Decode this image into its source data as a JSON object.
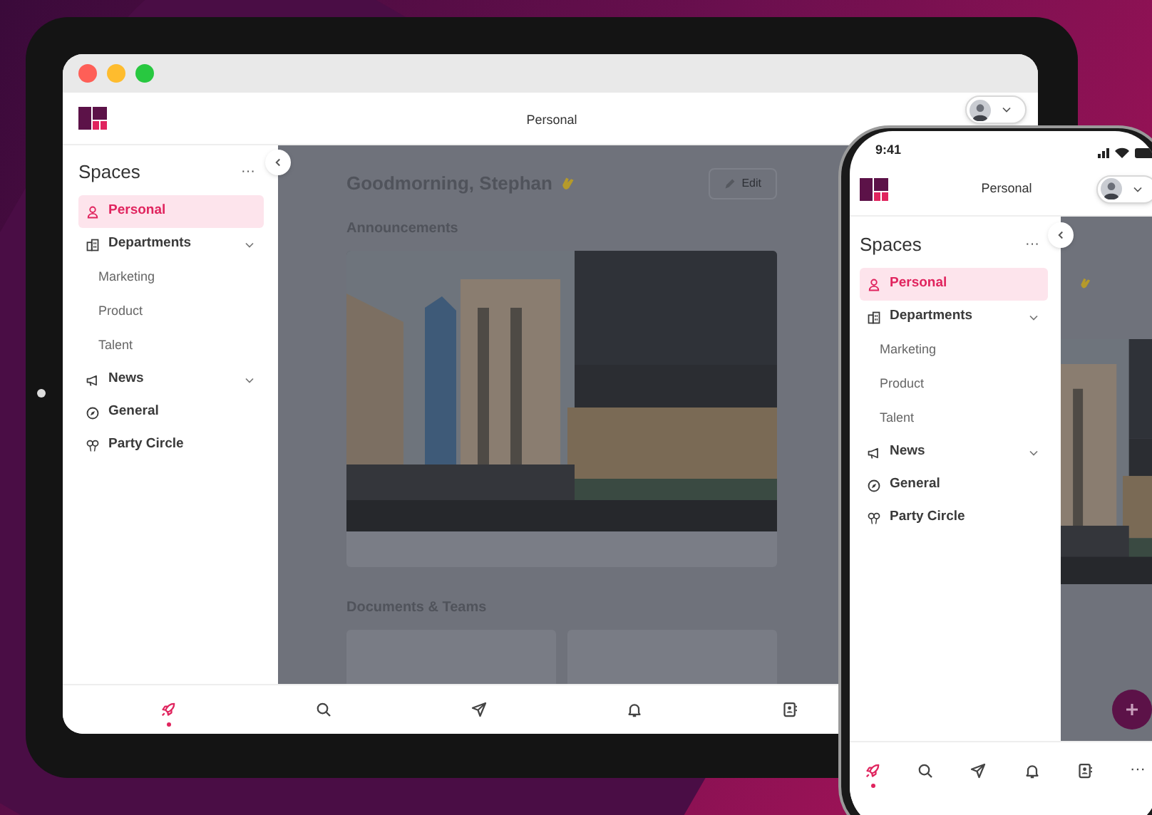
{
  "tablet": {
    "header": {
      "title": "Personal"
    },
    "sidebar": {
      "title": "Spaces",
      "more": "···",
      "items": [
        {
          "label": "Personal",
          "kind": "person",
          "selected": true,
          "chevron": false
        },
        {
          "label": "Departments",
          "kind": "building",
          "selected": false,
          "chevron": true,
          "children": [
            {
              "label": "Marketing",
              "selected": false
            },
            {
              "label": "Product",
              "selected": false
            },
            {
              "label": "Talent",
              "selected": false
            }
          ]
        },
        {
          "label": "News",
          "kind": "megaphone",
          "selected": false,
          "chevron": true
        },
        {
          "label": "General",
          "kind": "compass",
          "selected": false,
          "chevron": false
        },
        {
          "label": "Party Circle",
          "kind": "balloons",
          "selected": false,
          "chevron": false
        }
      ]
    },
    "content": {
      "greeting": "Goodmorning, Stephan",
      "edit": "Edit",
      "sections": [
        "Announcements",
        "Documents & Teams"
      ]
    },
    "bottom_nav": [
      {
        "kind": "rocket",
        "selected": true
      },
      {
        "kind": "search",
        "selected": false
      },
      {
        "kind": "send",
        "selected": false
      },
      {
        "kind": "bell",
        "selected": false
      },
      {
        "kind": "contacts",
        "selected": false
      }
    ]
  },
  "phone": {
    "status_bar": {
      "time": "9:41"
    },
    "header": {
      "title": "Personal"
    },
    "sidebar": {
      "title": "Spaces",
      "more": "···",
      "items": [
        {
          "label": "Personal",
          "kind": "person",
          "selected": true,
          "chevron": false
        },
        {
          "label": "Departments",
          "kind": "building",
          "selected": false,
          "chevron": true,
          "children": [
            {
              "label": "Marketing",
              "selected": false
            },
            {
              "label": "Product",
              "selected": false
            },
            {
              "label": "Talent",
              "selected": false
            }
          ]
        },
        {
          "label": "News",
          "kind": "megaphone",
          "selected": false,
          "chevron": true
        },
        {
          "label": "General",
          "kind": "compass",
          "selected": false,
          "chevron": false
        },
        {
          "label": "Party Circle",
          "kind": "balloons",
          "selected": false,
          "chevron": false
        }
      ]
    },
    "bottom_nav": [
      {
        "kind": "rocket",
        "selected": true
      },
      {
        "kind": "search",
        "selected": false
      },
      {
        "kind": "send",
        "selected": false
      },
      {
        "kind": "bell",
        "selected": false
      },
      {
        "kind": "contacts",
        "selected": false
      },
      {
        "kind": "more",
        "label": "···",
        "selected": false
      }
    ]
  }
}
